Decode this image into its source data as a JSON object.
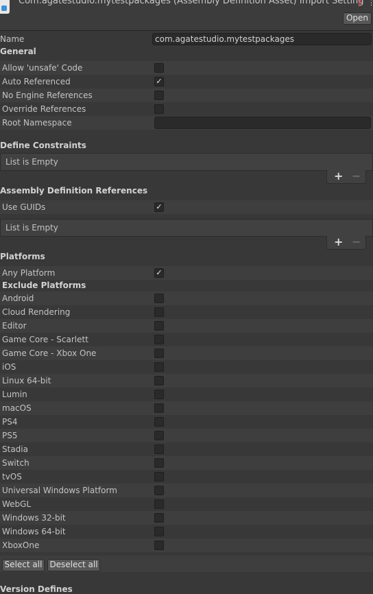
{
  "header": {
    "title": "Com.agatestudio.mytestpackages (Assembly Definition Asset) Import Setting",
    "open_label": "Open",
    "help_icon": "help-icon",
    "menu_icon": "kebab-menu-icon"
  },
  "name_field": {
    "label": "Name",
    "value": "com.agatestudio.mytestpackages"
  },
  "general": {
    "title": "General",
    "allow_unsafe": {
      "label": "Allow 'unsafe' Code",
      "checked": false
    },
    "auto_referenced": {
      "label": "Auto Referenced",
      "checked": true
    },
    "no_engine_refs": {
      "label": "No Engine References",
      "checked": false
    },
    "override_refs": {
      "label": "Override References",
      "checked": false
    },
    "root_namespace": {
      "label": "Root Namespace",
      "value": ""
    }
  },
  "define_constraints": {
    "title": "Define Constraints",
    "empty_text": "List is Empty"
  },
  "assembly_refs": {
    "title": "Assembly Definition References",
    "use_guids": {
      "label": "Use GUIDs",
      "checked": true
    },
    "empty_text": "List is Empty"
  },
  "list_controls": {
    "plus": "+",
    "minus": "−"
  },
  "platforms": {
    "title": "Platforms",
    "any_platform": {
      "label": "Any Platform",
      "checked": true
    },
    "exclude_title": "Exclude Platforms",
    "items": [
      "Android",
      "Cloud Rendering",
      "Editor",
      "Game Core - Scarlett",
      "Game Core - Xbox One",
      "iOS",
      "Linux 64-bit",
      "Lumin",
      "macOS",
      "PS4",
      "PS5",
      "Stadia",
      "Switch",
      "tvOS",
      "Universal Windows Platform",
      "WebGL",
      "Windows 32-bit",
      "Windows 64-bit",
      "XboxOne"
    ],
    "select_all": "Select all",
    "deselect_all": "Deselect all"
  },
  "version_defines": {
    "title": "Version Defines"
  },
  "colors": {
    "background": "#383838",
    "field": "#2a2a2a",
    "text": "#c4c4c4"
  }
}
